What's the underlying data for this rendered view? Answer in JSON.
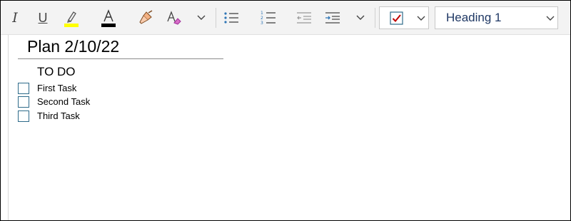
{
  "toolbar": {
    "style_select": {
      "value": "Heading 1"
    },
    "colors": {
      "highlight": "#ffff00",
      "font_color": "#000000",
      "accent": "#c00000",
      "style_text": "#1f3864"
    },
    "icons": [
      "italic-icon",
      "underline-icon",
      "highlight-icon",
      "font-color-icon",
      "format-painter-icon",
      "clear-formatting-icon",
      "chevron-down-icon",
      "bullet-list-icon",
      "numbered-list-icon",
      "decrease-indent-icon",
      "increase-indent-icon",
      "chevron-down-icon",
      "checkbox-tag-icon",
      "chevron-down-icon"
    ]
  },
  "page": {
    "title": "Plan 2/10/22",
    "heading": "TO DO",
    "tasks": [
      {
        "label": "First Task",
        "checked": false
      },
      {
        "label": "Second Task",
        "checked": false
      },
      {
        "label": "Third Task",
        "checked": false
      }
    ]
  }
}
